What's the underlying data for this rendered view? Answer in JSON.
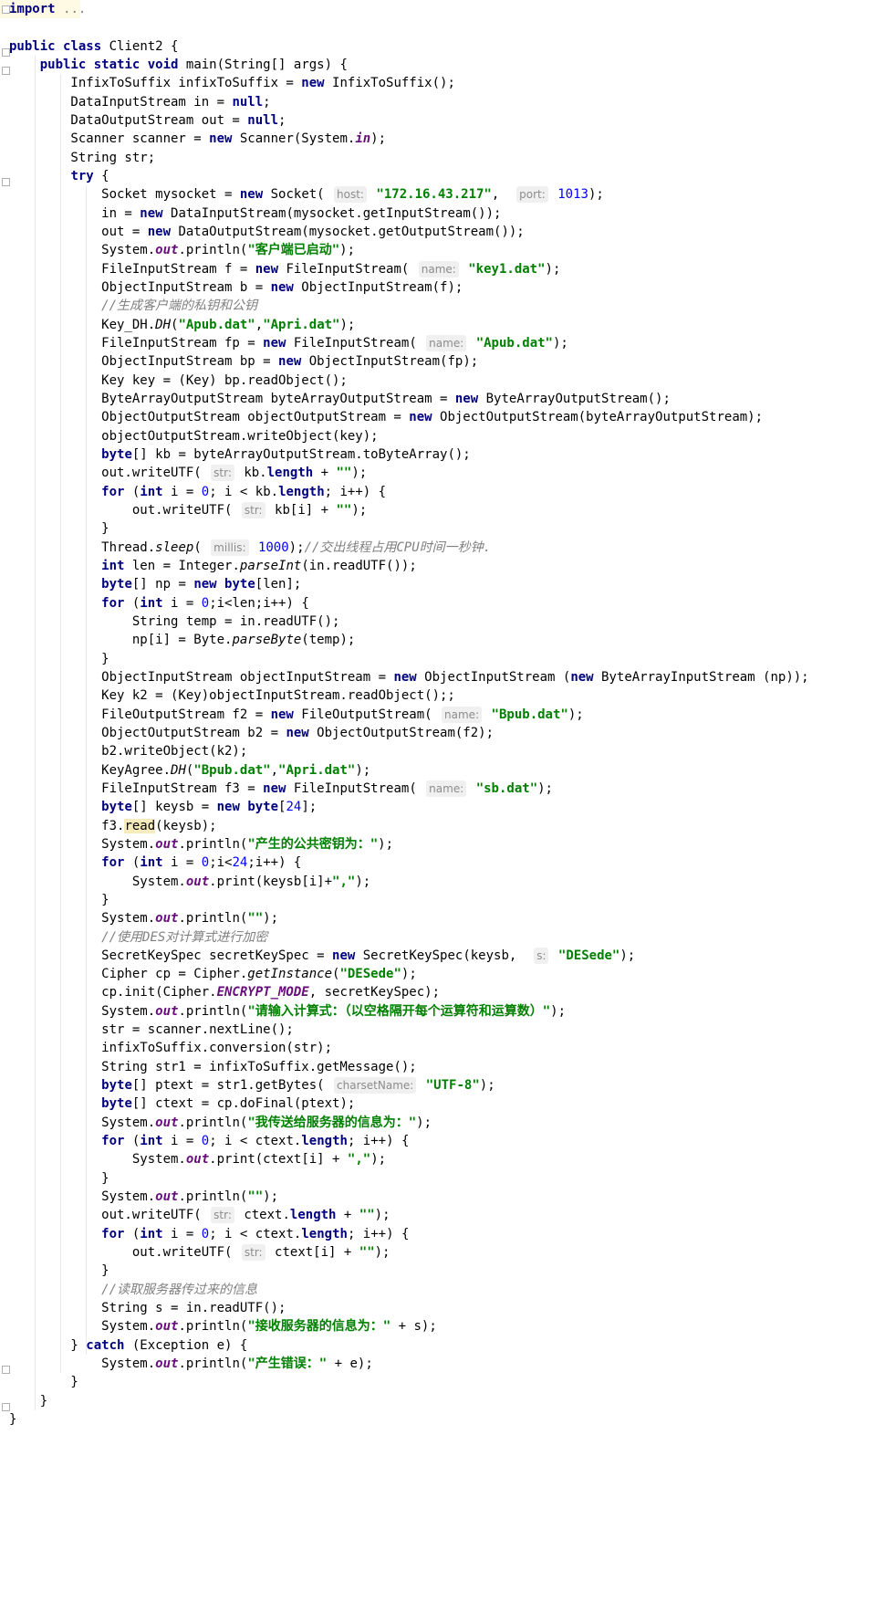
{
  "editor": {
    "language": "Java",
    "class_name": "Client2",
    "lines": [
      "import ...",
      "",
      "public class Client2 {",
      "    public static void main(String[] args) {",
      "        InfixToSuffix infixToSuffix = new InfixToSuffix();",
      "        DataInputStream in = null;",
      "        DataOutputStream out = null;",
      "        Scanner scanner = new Scanner(System.in);",
      "        String str;",
      "        try {",
      "            Socket mysocket = new Socket( host: \"172.16.43.217\",  port: 1013);",
      "            in = new DataInputStream(mysocket.getInputStream());",
      "            out = new DataOutputStream(mysocket.getOutputStream());",
      "            System.out.println(\"客户端已启动\");",
      "            FileInputStream f = new FileInputStream( name: \"key1.dat\");",
      "            ObjectInputStream b = new ObjectInputStream(f);",
      "            //生成客户端的私钥和公钥",
      "            Key_DH.DH(\"Apub.dat\",\"Apri.dat\");",
      "            FileInputStream fp = new FileInputStream( name: \"Apub.dat\");",
      "            ObjectInputStream bp = new ObjectInputStream(fp);",
      "            Key key = (Key) bp.readObject();",
      "            ByteArrayOutputStream byteArrayOutputStream = new ByteArrayOutputStream();",
      "            ObjectOutputStream objectOutputStream = new ObjectOutputStream(byteArrayOutputStream);",
      "            objectOutputStream.writeObject(key);",
      "            byte[] kb = byteArrayOutputStream.toByteArray();",
      "            out.writeUTF( str: kb.length + \"\");",
      "            for (int i = 0; i < kb.length; i++) {",
      "                out.writeUTF( str: kb[i] + \"\");",
      "            }",
      "            Thread.sleep( millis: 1000);//交出线程占用CPU时间一秒钟.",
      "            int len = Integer.parseInt(in.readUTF());",
      "            byte[] np = new byte[len];",
      "            for (int i = 0;i<len;i++) {",
      "                String temp = in.readUTF();",
      "                np[i] = Byte.parseByte(temp);",
      "            }",
      "            ObjectInputStream objectInputStream = new ObjectInputStream (new ByteArrayInputStream (np));",
      "            Key k2 = (Key)objectInputStream.readObject();;",
      "            FileOutputStream f2 = new FileOutputStream( name: \"Bpub.dat\");",
      "            ObjectOutputStream b2 = new ObjectOutputStream(f2);",
      "            b2.writeObject(k2);",
      "            KeyAgree.DH(\"Bpub.dat\",\"Apri.dat\");",
      "            FileInputStream f3 = new FileInputStream( name: \"sb.dat\");",
      "            byte[] keysb = new byte[24];",
      "            f3.read(keysb);",
      "            System.out.println(\"产生的公共密钥为：\");",
      "            for (int i = 0;i<24;i++) {",
      "                System.out.print(keysb[i]+\",\");",
      "            }",
      "            System.out.println(\"\");",
      "            //使用DES对计算式进行加密",
      "            SecretKeySpec secretKeySpec = new SecretKeySpec(keysb,  s: \"DESede\");",
      "            Cipher cp = Cipher.getInstance(\"DESede\");",
      "            cp.init(Cipher.ENCRYPT_MODE, secretKeySpec);",
      "            System.out.println(\"请输入计算式：（以空格隔开每个运算符和运算数）\");",
      "            str = scanner.nextLine();",
      "            infixToSuffix.conversion(str);",
      "            String str1 = infixToSuffix.getMessage();",
      "            byte[] ptext = str1.getBytes( charsetName: \"UTF-8\");",
      "            byte[] ctext = cp.doFinal(ptext);",
      "            System.out.println(\"我传送给服务器的信息为：\");",
      "            for (int i = 0; i < ctext.length; i++) {",
      "                System.out.print(ctext[i] + \",\");",
      "            }",
      "            System.out.println(\"\");",
      "            out.writeUTF( str: ctext.length + \"\");",
      "            for (int i = 0; i < ctext.length; i++) {",
      "                out.writeUTF( str: ctext[i] + \"\");",
      "            }",
      "            //读取服务器传过来的信息",
      "            String s = in.readUTF();",
      "            System.out.println(\"接收服务器的信息为：\" + s);",
      "        } catch (Exception e) {",
      "            System.out.println(\"产生错误：\" + e);",
      "        }",
      "    }",
      "}"
    ]
  }
}
